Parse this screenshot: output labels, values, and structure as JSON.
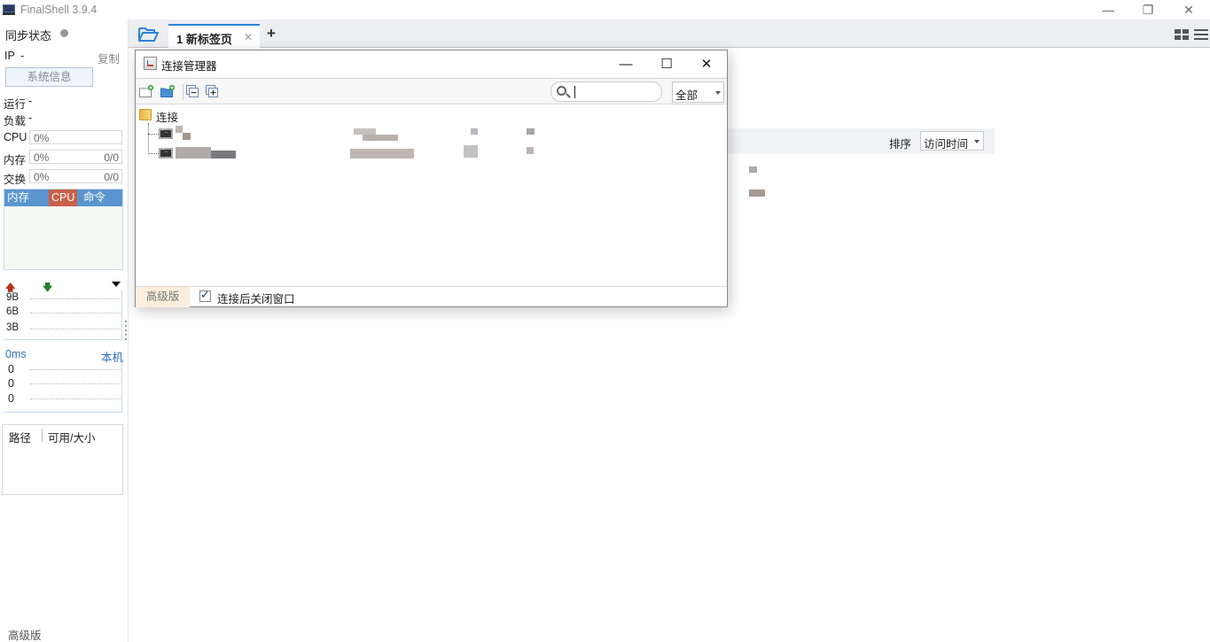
{
  "window": {
    "title": "FinalShell 3.9.4",
    "minimize_icon": "minimize-icon",
    "restore_icon": "restore-icon",
    "close_icon": "close-icon"
  },
  "sidebar": {
    "sync_status": "同步状态",
    "ip_label": "IP",
    "ip_value": "-",
    "copy": "复制",
    "sysinfo": "系统信息",
    "uptime_label": "运行",
    "uptime_value": "-",
    "load_label": "负载",
    "load_value": "-",
    "meters": [
      {
        "label": "CPU",
        "percent": "0%",
        "fraction": ""
      },
      {
        "label": "内存",
        "percent": "0%",
        "fraction": "0/0"
      },
      {
        "label": "交换",
        "percent": "0%",
        "fraction": "0/0"
      }
    ],
    "process_tabs": [
      "内存",
      "CPU",
      "命令"
    ],
    "process_tab_colors": {
      "active": "#c9604a",
      "inactive": "#5a95d0"
    },
    "network": {
      "upload_icon": "arrow-up-icon",
      "download_icon": "arrow-down-icon",
      "y_labels": [
        "9B",
        "6B",
        "3B"
      ]
    },
    "ping": {
      "latency": "0ms",
      "host": "本机",
      "y_labels": [
        "0",
        "0",
        "0"
      ]
    },
    "disk": {
      "columns": [
        "路径",
        "可用/大小"
      ]
    },
    "pro_label": "高级版"
  },
  "tabs": {
    "folder_icon": "folder-open-icon",
    "items": [
      {
        "label": "1 新标签页",
        "active": true
      }
    ],
    "add_icon": "plus-icon",
    "accent": "#2d83d8"
  },
  "main": {
    "sort_label": "排序",
    "sort_value": "访问时间"
  },
  "dialog": {
    "title": "连接管理器",
    "search": {
      "value": "",
      "placeholder": ""
    },
    "filter_value": "全部",
    "tree": {
      "root": "连接",
      "items": [
        {
          "name": "[redacted]",
          "type": "ssh"
        },
        {
          "name": "[redacted]",
          "type": "ssh"
        }
      ]
    },
    "footer": {
      "pro_label": "高级版",
      "close_after_connect_label": "连接后关闭窗口",
      "close_after_connect_checked": true
    }
  }
}
